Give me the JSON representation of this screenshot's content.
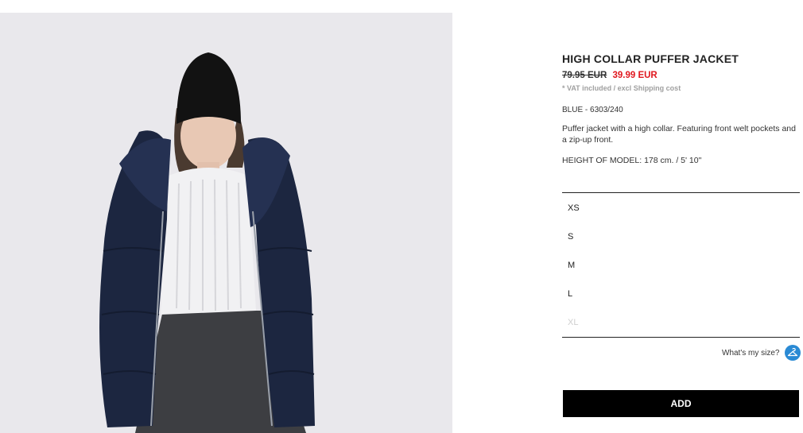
{
  "product": {
    "title": "HIGH COLLAR PUFFER JACKET",
    "old_price": "79.95 EUR",
    "new_price": "39.99 EUR",
    "vat_note": "* VAT included / excl Shipping cost",
    "color_ref": "BLUE - 6303/240",
    "description": "Puffer jacket with a high collar. Featuring front welt pockets and a zip-up front.",
    "model_height": "HEIGHT OF MODEL: 178 cm. / 5' 10\""
  },
  "sizes": [
    {
      "label": "XS",
      "available": true
    },
    {
      "label": "S",
      "available": true
    },
    {
      "label": "M",
      "available": true
    },
    {
      "label": "L",
      "available": true
    },
    {
      "label": "XL",
      "available": false
    }
  ],
  "size_help": {
    "label": "What's my size?",
    "icon": "hanger-icon"
  },
  "add_button": {
    "label": "ADD"
  },
  "colors": {
    "sale": "#e0171e",
    "accent": "#2a8ad4",
    "button": "#000000"
  }
}
